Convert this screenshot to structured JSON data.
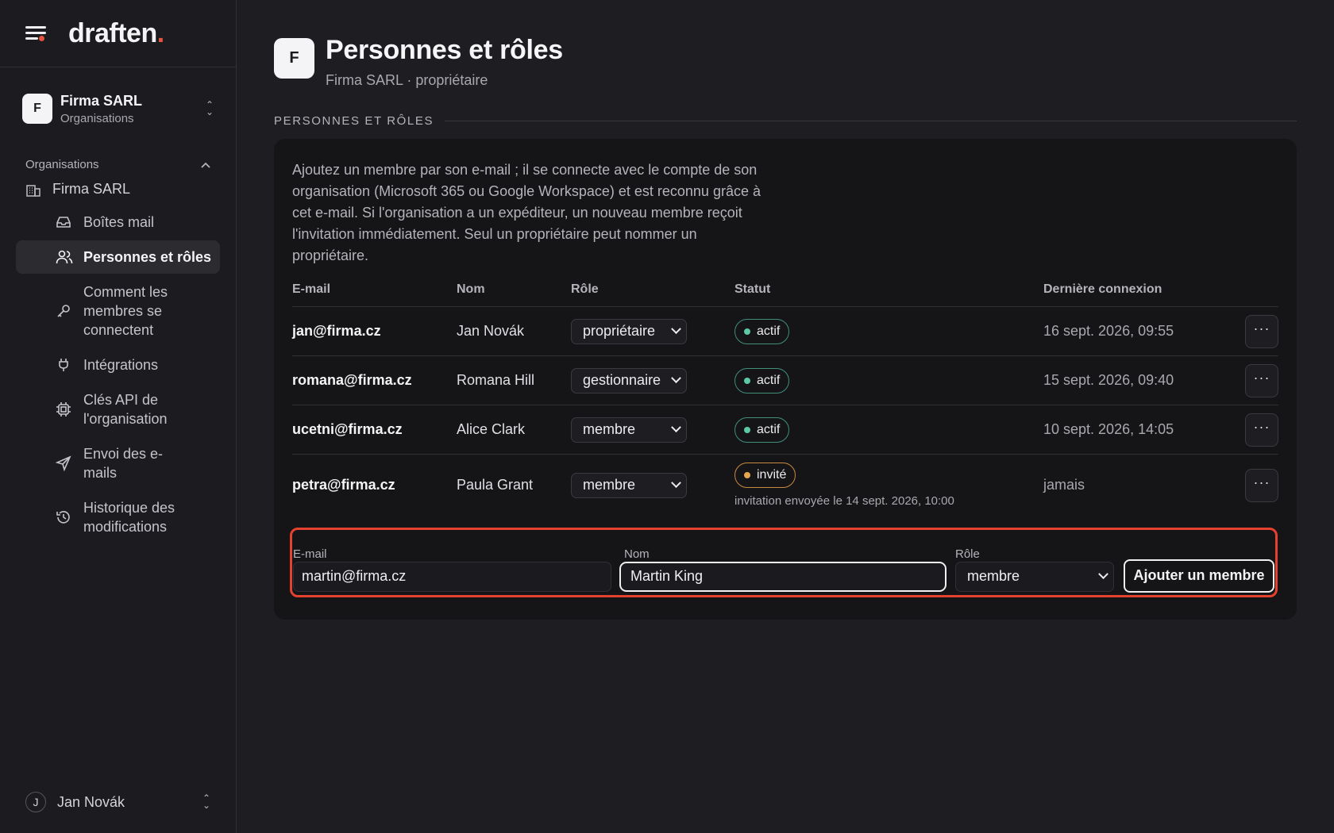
{
  "app": {
    "logo": "draften",
    "logo_dot": "."
  },
  "sidebar": {
    "org_switcher": {
      "initial": "F",
      "name": "Firma SARL",
      "sub": "Organisations"
    },
    "section_label": "Organisations",
    "org_item": "Firma SARL",
    "items": [
      {
        "label": "Boîtes mail",
        "icon": "inbox-icon"
      },
      {
        "label": "Personnes et rôles",
        "icon": "users-icon",
        "active": true
      },
      {
        "label": "Comment les membres se connectent",
        "icon": "key-icon"
      },
      {
        "label": "Intégrations",
        "icon": "plug-icon"
      },
      {
        "label": "Clés API de l'organisation",
        "icon": "chip-icon"
      },
      {
        "label": "Envoi des e-mails",
        "icon": "send-icon"
      },
      {
        "label": "Historique des modifications",
        "icon": "history-icon"
      }
    ],
    "user": {
      "initial": "J",
      "name": "Jan Novák"
    }
  },
  "page": {
    "initial": "F",
    "title": "Personnes et rôles",
    "subtitle": "Firma SARL · propriétaire",
    "section_label": "PERSONNES ET RÔLES",
    "intro": "Ajoutez un membre par son e-mail ; il se connecte avec le compte de son organisation (Microsoft 365 ou Google Workspace) et est reconnu grâce à cet e-mail. Si l'organisation a un expéditeur, un nouveau membre reçoit l'invitation immédiatement. Seul un propriétaire peut nommer un propriétaire."
  },
  "table": {
    "headers": {
      "email": "E-mail",
      "name": "Nom",
      "role": "Rôle",
      "status": "Statut",
      "last": "Dernière connexion"
    },
    "rows": [
      {
        "email": "jan@firma.cz",
        "name": "Jan Novák",
        "role": "propriétaire",
        "status": "actif",
        "last": "16 sept. 2026, 09:55"
      },
      {
        "email": "romana@firma.cz",
        "name": "Romana Hill",
        "role": "gestionnaire",
        "status": "actif",
        "last": "15 sept. 2026, 09:40"
      },
      {
        "email": "ucetni@firma.cz",
        "name": "Alice Clark",
        "role": "membre",
        "status": "actif",
        "last": "10 sept. 2026, 14:05"
      },
      {
        "email": "petra@firma.cz",
        "name": "Paula Grant",
        "role": "membre",
        "status": "invité",
        "note": "invitation envoyée le 14 sept. 2026, 10:00",
        "last": "jamais"
      }
    ],
    "more": "···"
  },
  "add_form": {
    "email_label": "E-mail",
    "email_value": "martin@firma.cz",
    "name_label": "Nom",
    "name_value": "Martin King",
    "role_label": "Rôle",
    "role_value": "membre",
    "submit": "Ajouter un membre"
  },
  "colors": {
    "accent": "#e5412f",
    "active": "#5cc9a3",
    "invited": "#e6a64e"
  }
}
